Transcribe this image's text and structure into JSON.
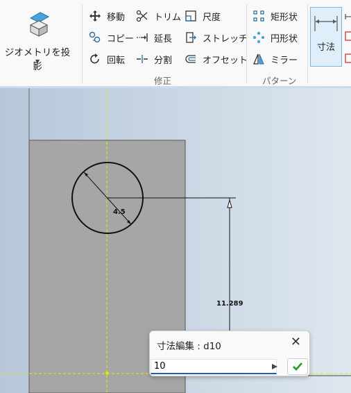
{
  "ribbon": {
    "geometry": {
      "label": "ジオメトリを投影"
    },
    "modify": {
      "group_label": "修正",
      "items": [
        {
          "name": "move",
          "label": "移動"
        },
        {
          "name": "trim",
          "label": "トリム"
        },
        {
          "name": "scale",
          "label": "尺度"
        },
        {
          "name": "copy",
          "label": "コピー"
        },
        {
          "name": "extend",
          "label": "延長"
        },
        {
          "name": "stretch",
          "label": "ストレッチ"
        },
        {
          "name": "rotate",
          "label": "回転"
        },
        {
          "name": "split",
          "label": "分割"
        },
        {
          "name": "offset",
          "label": "オフセット"
        }
      ]
    },
    "pattern": {
      "group_label": "パターン",
      "items": [
        {
          "name": "rect-pattern",
          "label": "矩形状"
        },
        {
          "name": "circ-pattern",
          "label": "円形状"
        },
        {
          "name": "mirror",
          "label": "ミラー"
        }
      ]
    },
    "dimension": {
      "label": "寸法"
    }
  },
  "canvas": {
    "dims": {
      "diameter": "4.5",
      "vertical": "11.289"
    }
  },
  "dialog": {
    "title": "寸法編集 : d10",
    "value": "10"
  },
  "colors": {
    "accent": "#1f5fb8",
    "ok": "#2e9c2e",
    "part_fill": "#a6a6a6"
  }
}
